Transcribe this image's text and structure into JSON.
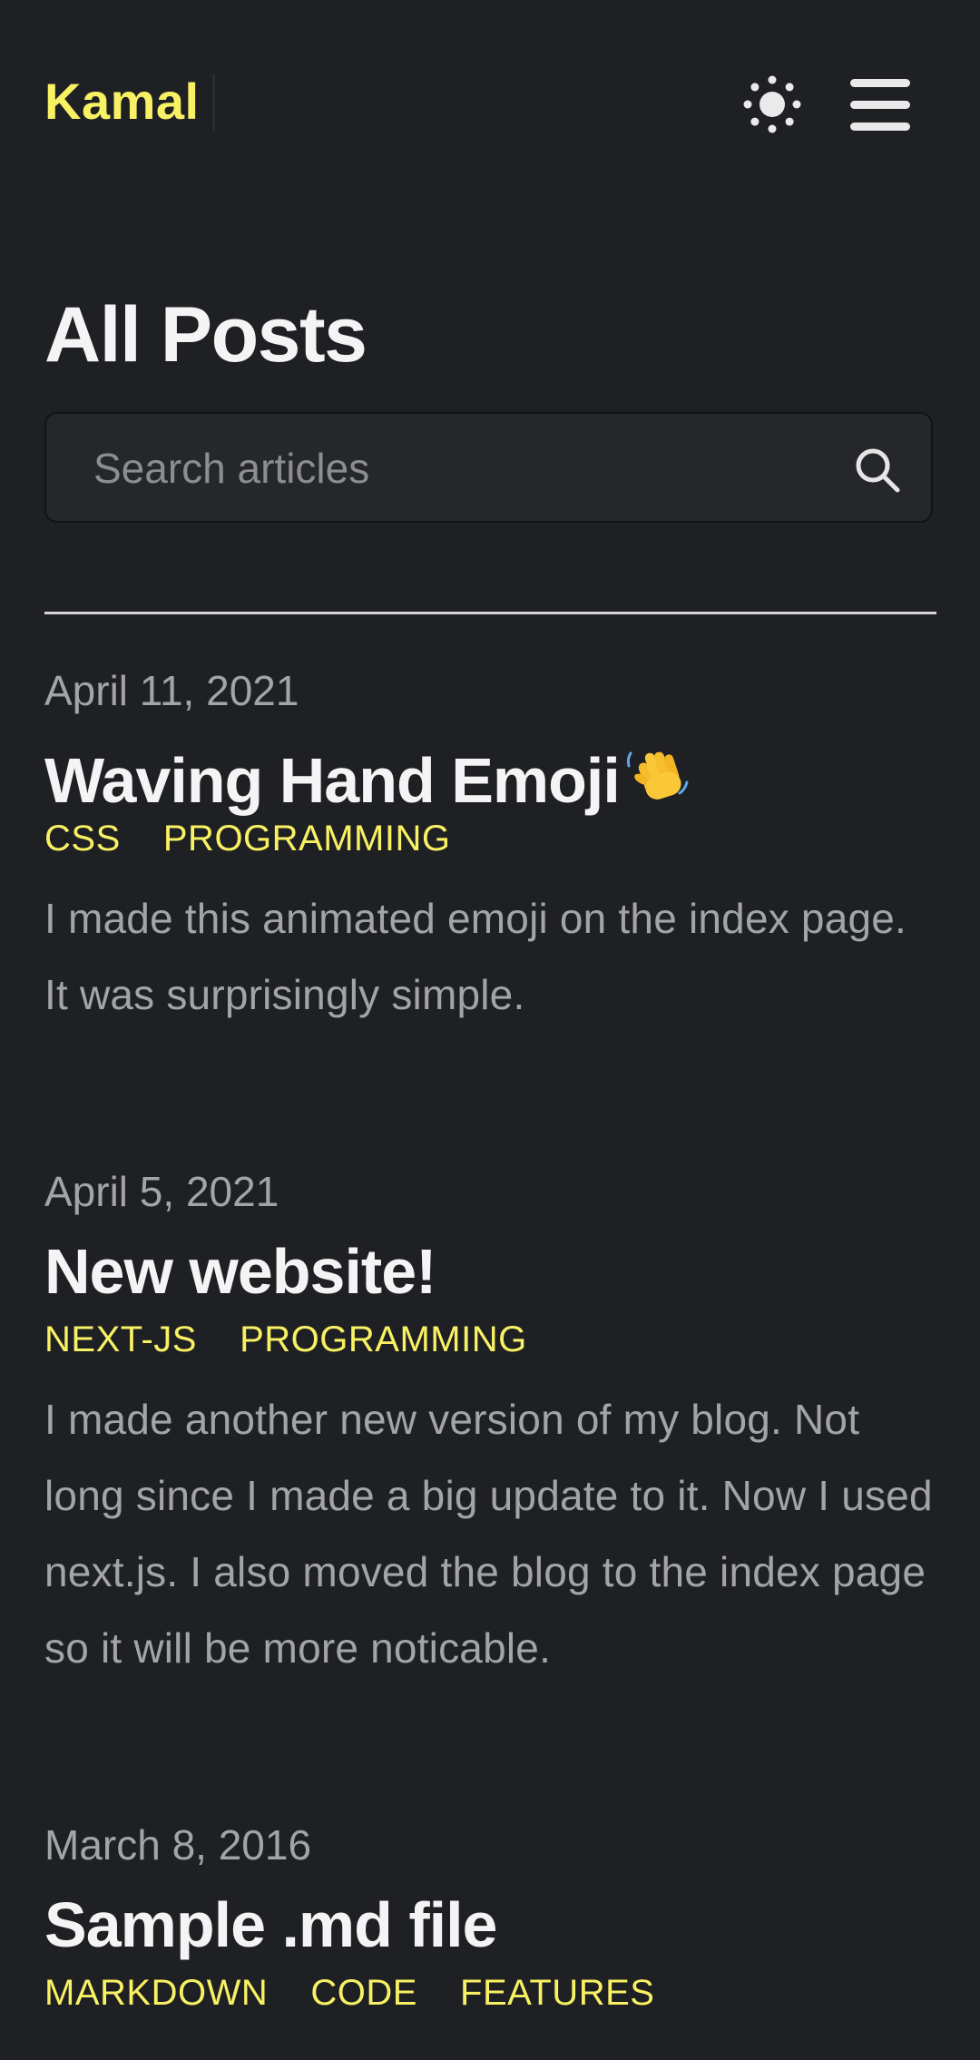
{
  "header": {
    "brand": "Kamal",
    "theme_toggle_icon": "sun-icon",
    "menu_icon": "hamburger-menu-icon"
  },
  "main": {
    "title": "All Posts",
    "search": {
      "placeholder": "Search articles",
      "value": "",
      "icon": "search-icon"
    },
    "posts": [
      {
        "date": "April 11, 2021",
        "title": "Waving Hand Emoji",
        "title_emoji": "waving-hand-emoji-icon",
        "tags": [
          "CSS",
          "PROGRAMMING"
        ],
        "excerpt": "I made this animated emoji on the index page. It was surprisingly simple."
      },
      {
        "date": "April 5, 2021",
        "title": "New website!",
        "tags": [
          "NEXT-JS",
          "PROGRAMMING"
        ],
        "excerpt": "I made another new version of my blog. Not long since I made a big update to it. Now I used next.js. I also moved the blog to the index page so it will be more noticable."
      },
      {
        "date": "March 8, 2016",
        "title": "Sample .md file",
        "tags": [
          "MARKDOWN",
          "CODE",
          "FEATURES"
        ],
        "excerpt": ""
      }
    ]
  },
  "colors": {
    "background": "#1f2024",
    "accent": "#f8f163",
    "text": "#f4f4f5",
    "muted": "#a3a4a8",
    "divider": "#d6d6d8"
  }
}
